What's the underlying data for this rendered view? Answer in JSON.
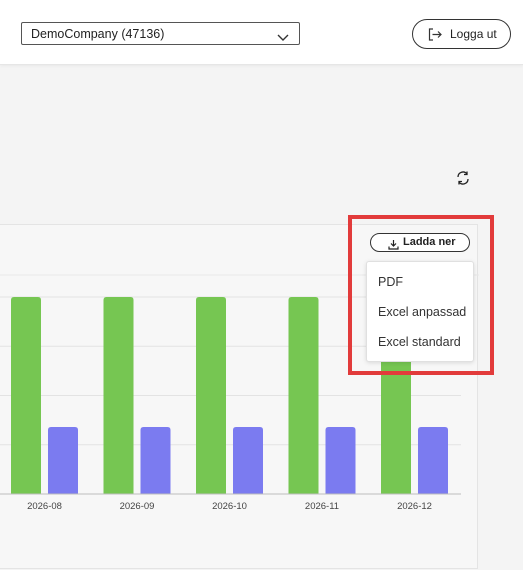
{
  "header": {
    "company_select": {
      "value": "DemoCompany (47136)"
    },
    "logout_label": "Logga ut"
  },
  "toolbar": {
    "download_label": "Ladda ner",
    "download_options": [
      "PDF",
      "Excel anpassad",
      "Excel standard"
    ]
  },
  "colors": {
    "green": "#76c652",
    "purple": "#7b7bf0",
    "highlight": "#e23b3b"
  },
  "chart_data": {
    "type": "bar",
    "categories": [
      "2026-08",
      "2026-09",
      "2026-10",
      "2026-11",
      "2026-12"
    ],
    "series": [
      {
        "values": [
          100,
          100,
          100,
          100,
          100
        ]
      },
      {
        "values": [
          34,
          34,
          34,
          34,
          34
        ]
      }
    ],
    "ylim": [
      0,
      100
    ],
    "grid": true
  }
}
